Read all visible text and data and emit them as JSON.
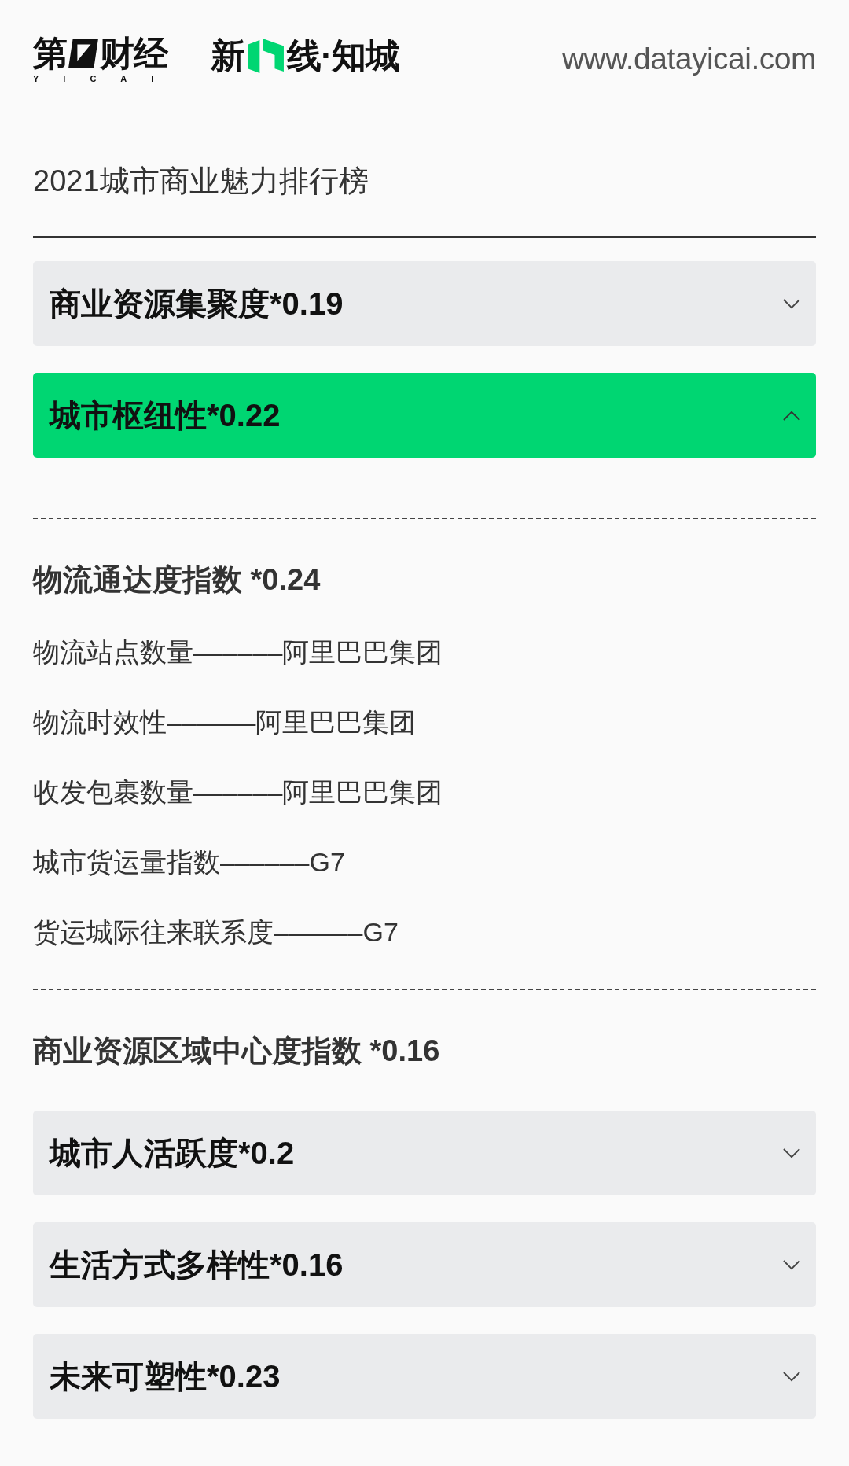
{
  "header": {
    "brand": {
      "before_mark": "第",
      "after_mark": "财经",
      "tagline": "YICAI"
    },
    "partner": {
      "before_mark": "新",
      "after_mark": "线·知城"
    },
    "url": "www.datayicai.com"
  },
  "title": "2021城市商业魅力排行榜",
  "accordion": [
    {
      "label": "商业资源集聚度*0.19",
      "expanded": false
    },
    {
      "label": "城市枢纽性*0.22",
      "expanded": true,
      "sections": [
        {
          "heading": "物流通达度指数 *0.24",
          "items": [
            "物流站点数量––––––阿里巴巴集团",
            "物流时效性––––––阿里巴巴集团",
            "收发包裹数量––––––阿里巴巴集团",
            "城市货运量指数––––––G7",
            "货运城际往来联系度––––––G7"
          ]
        },
        {
          "heading": "商业资源区域中心度指数 *0.16"
        }
      ]
    },
    {
      "label": "城市人活跃度*0.2",
      "expanded": false
    },
    {
      "label": "生活方式多样性*0.16",
      "expanded": false
    },
    {
      "label": "未来可塑性*0.23",
      "expanded": false
    }
  ]
}
